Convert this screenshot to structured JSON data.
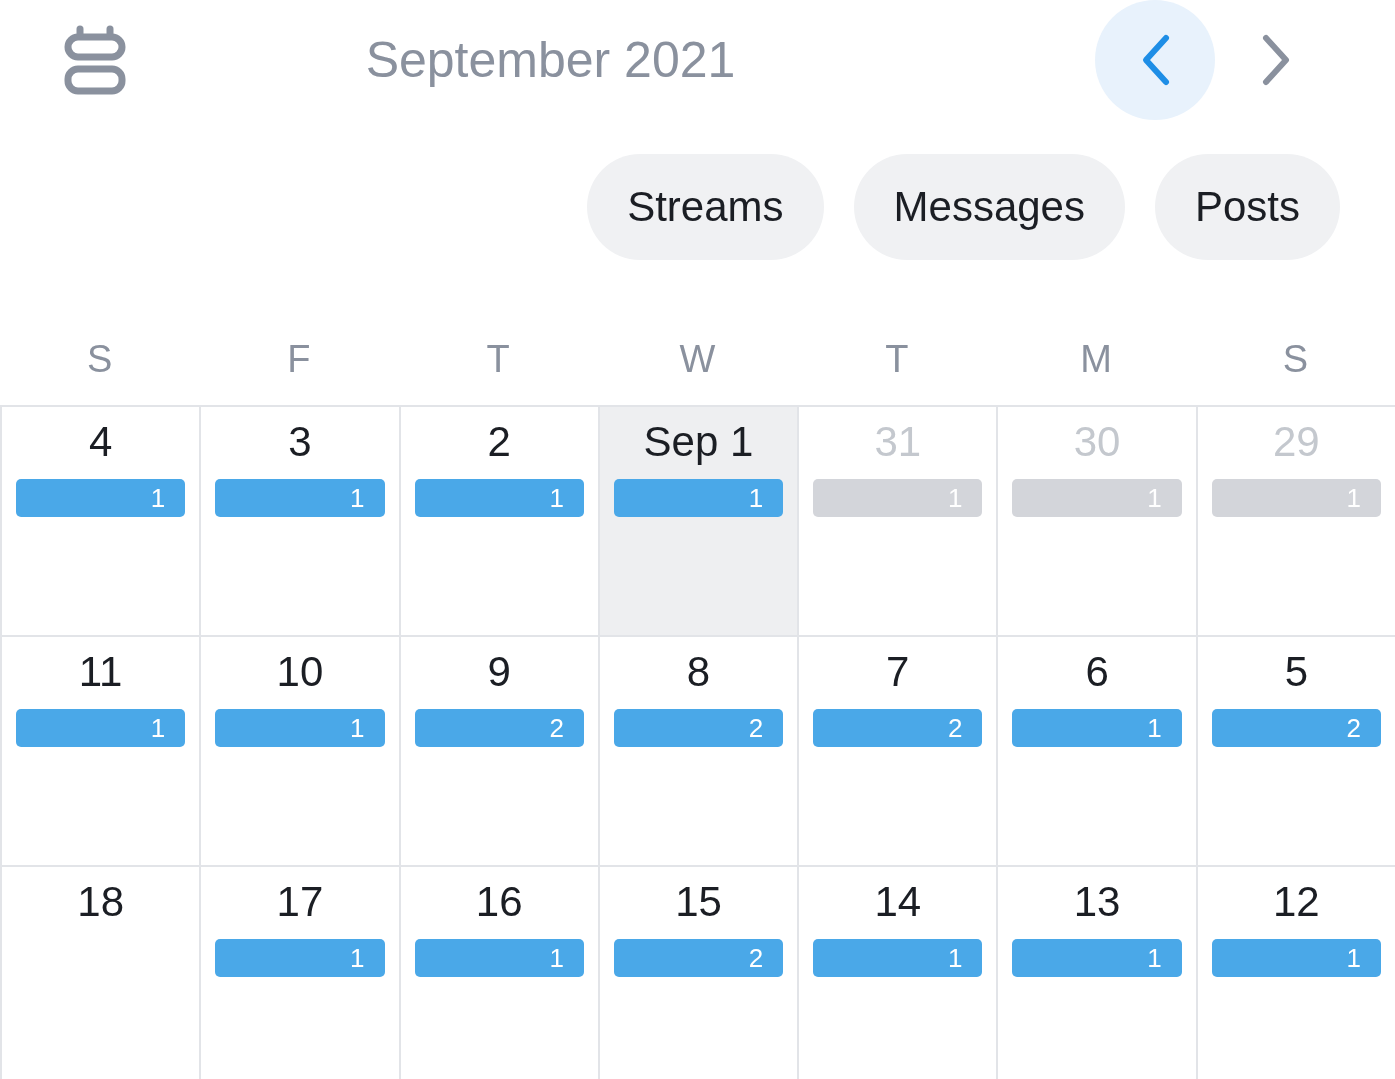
{
  "header": {
    "title": "September 2021"
  },
  "filters": [
    {
      "label": "Streams"
    },
    {
      "label": "Messages"
    },
    {
      "label": "Posts"
    }
  ],
  "weekdays": [
    "S",
    "F",
    "T",
    "W",
    "T",
    "M",
    "S"
  ],
  "weeks": [
    [
      {
        "label": "4",
        "muted": false,
        "today": false,
        "count": "1"
      },
      {
        "label": "3",
        "muted": false,
        "today": false,
        "count": "1"
      },
      {
        "label": "2",
        "muted": false,
        "today": false,
        "count": "1"
      },
      {
        "label": "Sep 1",
        "muted": false,
        "today": true,
        "count": "1"
      },
      {
        "label": "31",
        "muted": true,
        "today": false,
        "count": "1"
      },
      {
        "label": "30",
        "muted": true,
        "today": false,
        "count": "1"
      },
      {
        "label": "29",
        "muted": true,
        "today": false,
        "count": "1"
      }
    ],
    [
      {
        "label": "11",
        "muted": false,
        "today": false,
        "count": "1"
      },
      {
        "label": "10",
        "muted": false,
        "today": false,
        "count": "1"
      },
      {
        "label": "9",
        "muted": false,
        "today": false,
        "count": "2"
      },
      {
        "label": "8",
        "muted": false,
        "today": false,
        "count": "2"
      },
      {
        "label": "7",
        "muted": false,
        "today": false,
        "count": "2"
      },
      {
        "label": "6",
        "muted": false,
        "today": false,
        "count": "1"
      },
      {
        "label": "5",
        "muted": false,
        "today": false,
        "count": "2"
      }
    ],
    [
      {
        "label": "18",
        "muted": false,
        "today": false
      },
      {
        "label": "17",
        "muted": false,
        "today": false,
        "count": "1"
      },
      {
        "label": "16",
        "muted": false,
        "today": false,
        "count": "1"
      },
      {
        "label": "15",
        "muted": false,
        "today": false,
        "count": "2"
      },
      {
        "label": "14",
        "muted": false,
        "today": false,
        "count": "1"
      },
      {
        "label": "13",
        "muted": false,
        "today": false,
        "count": "1"
      },
      {
        "label": "12",
        "muted": false,
        "today": false,
        "count": "1"
      }
    ]
  ]
}
